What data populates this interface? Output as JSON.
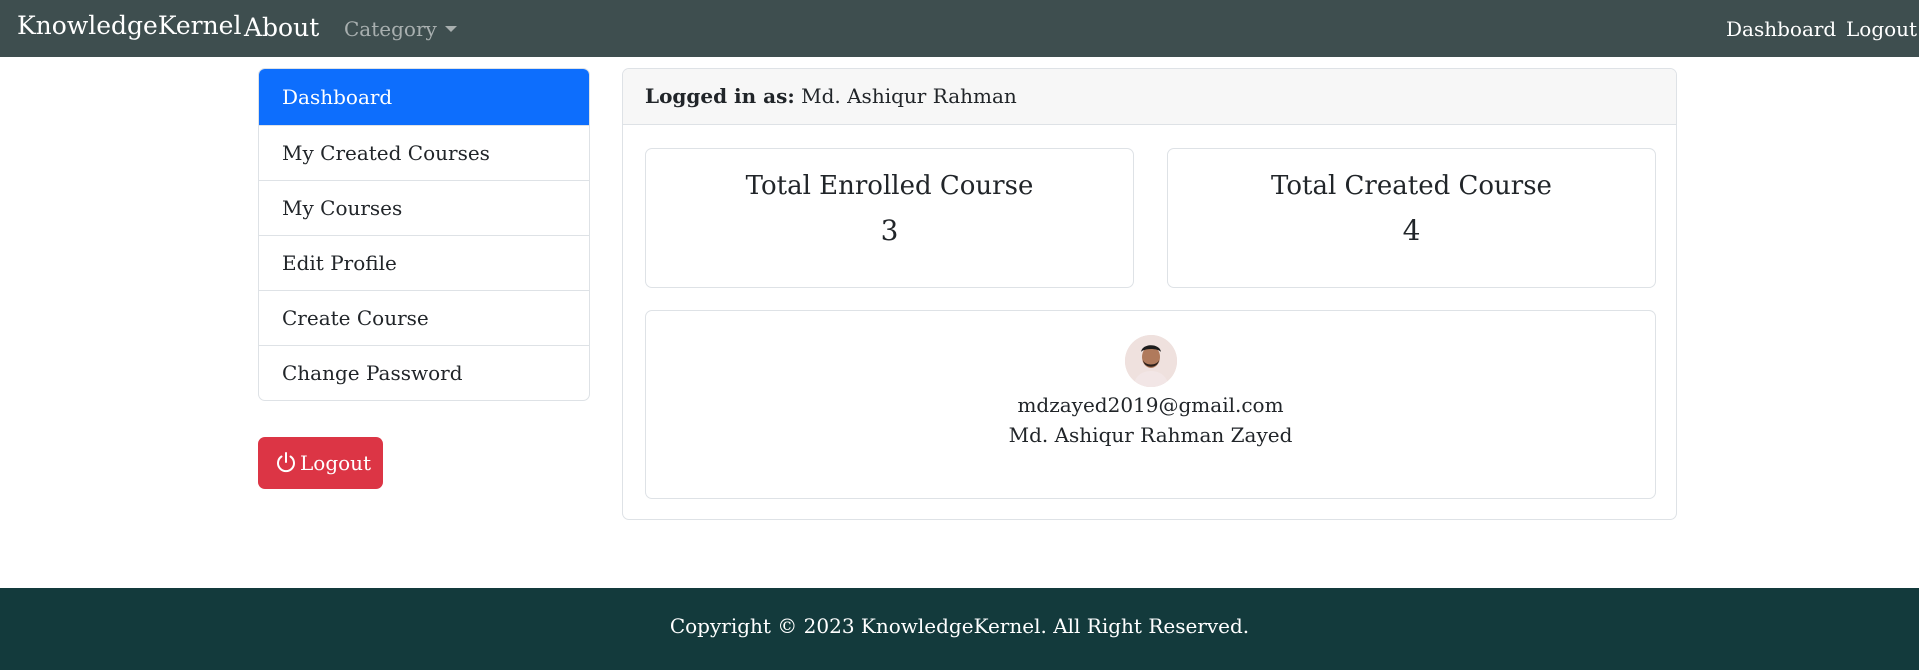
{
  "navbar": {
    "brand": "KnowledgeKernel",
    "about": "About",
    "category": "Category",
    "dashboard": "Dashboard",
    "logout": "Logout"
  },
  "sidebar": {
    "items": [
      {
        "label": "Dashboard",
        "active": true
      },
      {
        "label": "My Created Courses"
      },
      {
        "label": "My Courses"
      },
      {
        "label": "Edit Profile"
      },
      {
        "label": "Create Course"
      },
      {
        "label": "Change Password"
      }
    ]
  },
  "logout_button": {
    "label": "Logout",
    "icon": "power-icon",
    "color": "#dc3545"
  },
  "main": {
    "logged_in_label": "Logged in as:",
    "logged_in_name": "Md. Ashiqur Rahman",
    "stats": [
      {
        "title": "Total Enrolled Course",
        "value": "3"
      },
      {
        "title": "Total Created Course",
        "value": "4"
      }
    ],
    "profile": {
      "email": "mdzayed2019@gmail.com",
      "name": "Md. Ashiqur Rahman Zayed"
    }
  },
  "footer": {
    "text": "Copyright © 2023 KnowledgeKernel. All Right Reserved."
  },
  "colors": {
    "navbar": "#3e4e4f",
    "active": "#0d6efd",
    "footer": "#133a3c"
  }
}
